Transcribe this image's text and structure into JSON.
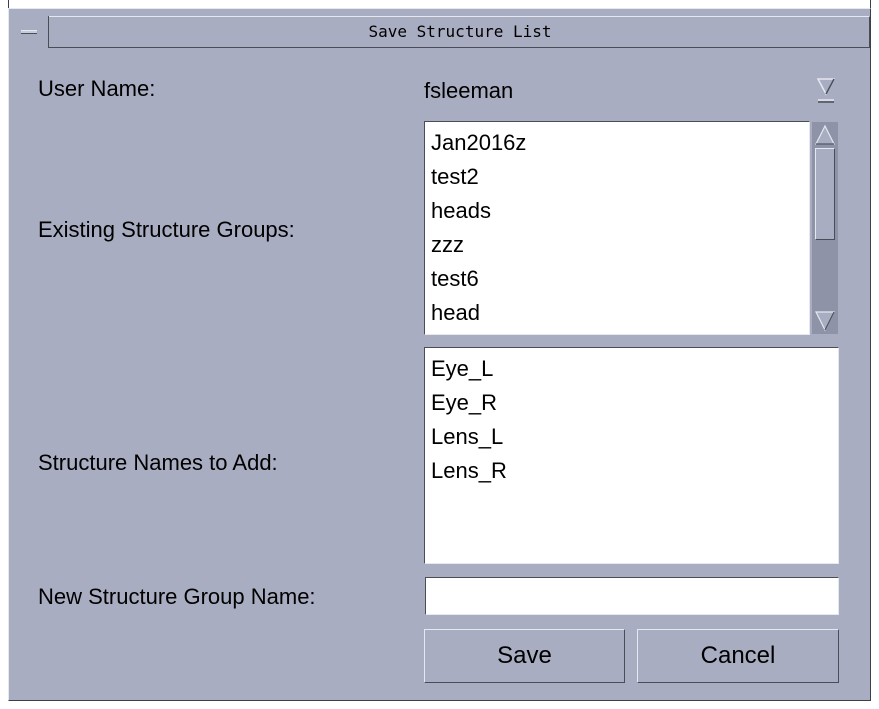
{
  "window": {
    "title": "Save Structure List"
  },
  "user": {
    "label": "User Name:",
    "value": "fsleeman"
  },
  "existing_groups": {
    "label": "Existing Structure Groups:",
    "items": [
      "Jan2016z",
      "test2",
      "heads",
      "zzz",
      "test6",
      "head"
    ]
  },
  "structures": {
    "label": "Structure Names to Add:",
    "items": [
      "Eye_L",
      "Eye_R",
      "Lens_L",
      "Lens_R"
    ]
  },
  "new_group": {
    "label": "New Structure Group Name:",
    "value": ""
  },
  "buttons": {
    "save": "Save",
    "cancel": "Cancel"
  },
  "colors": {
    "background": "#a9adc1",
    "list_background": "#ffffff"
  }
}
